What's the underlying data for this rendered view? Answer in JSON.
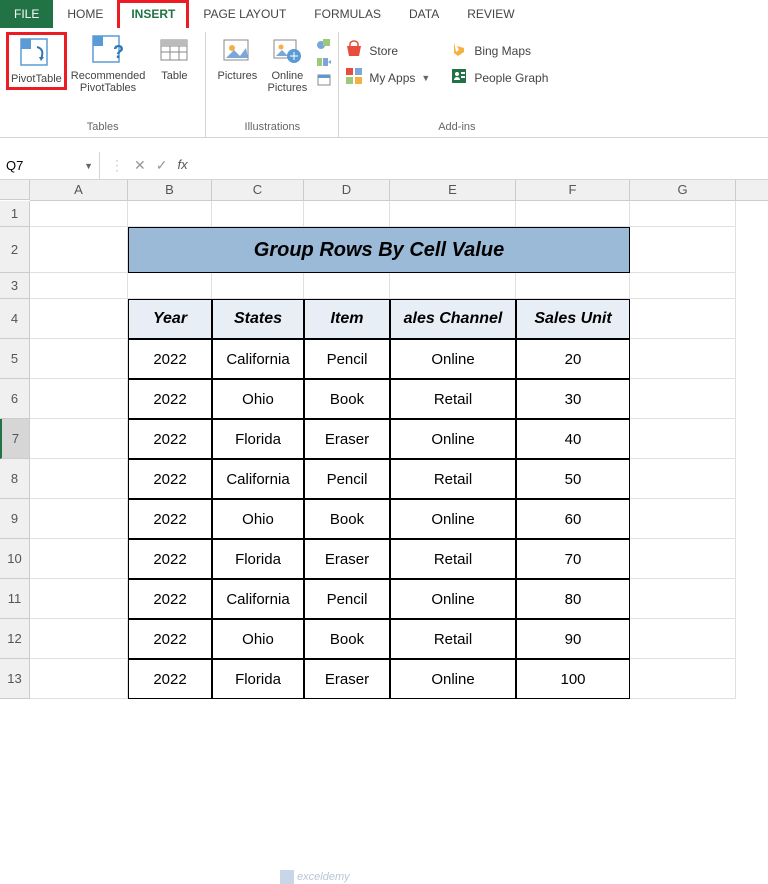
{
  "tabs": {
    "file": "FILE",
    "home": "HOME",
    "insert": "INSERT",
    "pageLayout": "PAGE LAYOUT",
    "formulas": "FORMULAS",
    "data": "DATA",
    "review": "REVIEW"
  },
  "ribbon": {
    "tables": {
      "pivot": "PivotTable",
      "recommended1": "Recommended",
      "recommended2": "PivotTables",
      "table": "Table",
      "label": "Tables"
    },
    "illus": {
      "pictures": "Pictures",
      "online1": "Online",
      "online2": "Pictures",
      "label": "Illustrations"
    },
    "addins": {
      "store": "Store",
      "myapps": "My Apps",
      "bing": "Bing Maps",
      "people": "People Graph",
      "label": "Add-ins"
    }
  },
  "namebox": "Q7",
  "columns": [
    "A",
    "B",
    "C",
    "D",
    "E",
    "F",
    "G"
  ],
  "rowNums": [
    "1",
    "2",
    "3",
    "4",
    "5",
    "6",
    "7",
    "8",
    "9",
    "10",
    "11",
    "12",
    "13"
  ],
  "activeRow": 7,
  "title": "Group Rows By Cell Value",
  "headers": {
    "year": "Year",
    "states": "States",
    "item": "Item",
    "channel": "ales Channel",
    "unit": "Sales Unit"
  },
  "data": [
    {
      "year": "2022",
      "state": "California",
      "item": "Pencil",
      "ch": "Online",
      "unit": "20"
    },
    {
      "year": "2022",
      "state": "Ohio",
      "item": "Book",
      "ch": "Retail",
      "unit": "30"
    },
    {
      "year": "2022",
      "state": "Florida",
      "item": "Eraser",
      "ch": "Online",
      "unit": "40"
    },
    {
      "year": "2022",
      "state": "California",
      "item": "Pencil",
      "ch": "Retail",
      "unit": "50"
    },
    {
      "year": "2022",
      "state": "Ohio",
      "item": "Book",
      "ch": "Online",
      "unit": "60"
    },
    {
      "year": "2022",
      "state": "Florida",
      "item": "Eraser",
      "ch": "Retail",
      "unit": "70"
    },
    {
      "year": "2022",
      "state": "California",
      "item": "Pencil",
      "ch": "Online",
      "unit": "80"
    },
    {
      "year": "2022",
      "state": "Ohio",
      "item": "Book",
      "ch": "Retail",
      "unit": "90"
    },
    {
      "year": "2022",
      "state": "Florida",
      "item": "Eraser",
      "ch": "Online",
      "unit": "100"
    }
  ],
  "watermark": "exceldemy"
}
